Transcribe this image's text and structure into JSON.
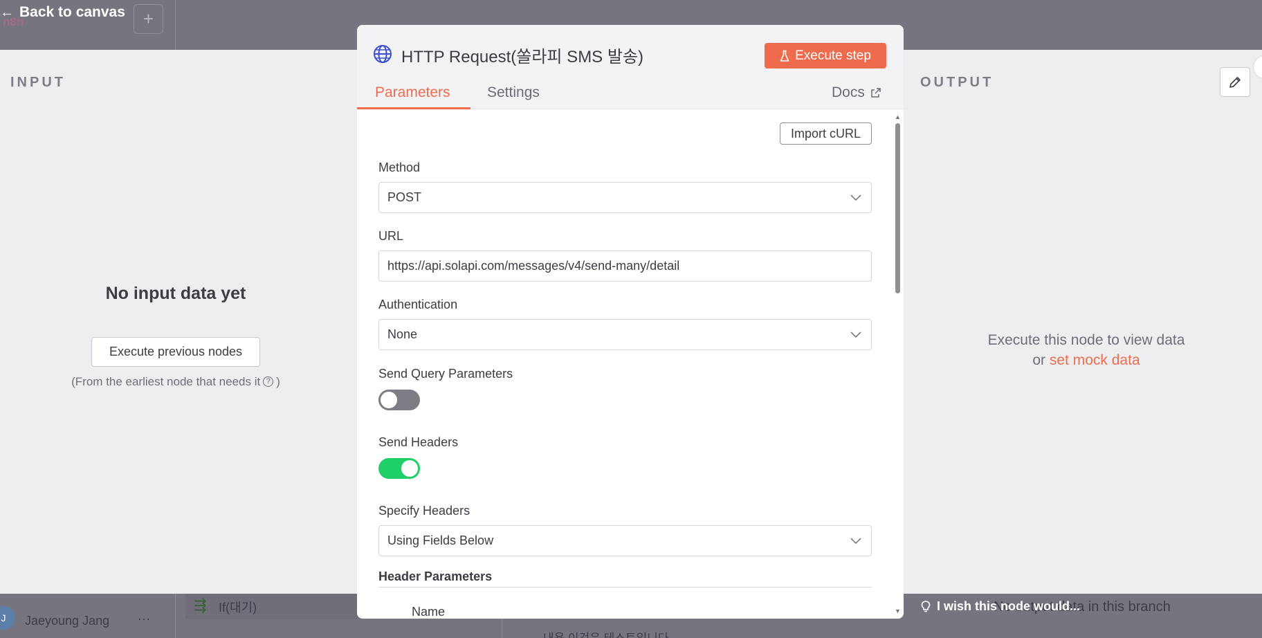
{
  "topbar": {
    "back_label": "Back to canvas",
    "back_arrow": "←",
    "logo_ghost": "n8n",
    "plus_label": "+"
  },
  "input_panel": {
    "title": "INPUT",
    "empty_title": "No input data yet",
    "execute_prev_label": "Execute previous nodes",
    "hint_prefix": "(From the earliest node that needs it",
    "hint_suffix": ")",
    "help_glyph": "?"
  },
  "output_panel": {
    "title": "OUTPUT",
    "execute_line": "Execute this node to view data",
    "or_text": "or",
    "mock_link": "set mock data"
  },
  "modal": {
    "title": "HTTP Request(쏠라피 SMS 발송)",
    "execute_step_label": "Execute step",
    "tabs": [
      {
        "label": "Parameters",
        "active": true
      },
      {
        "label": "Settings",
        "active": false
      }
    ],
    "docs_label": "Docs",
    "import_curl_label": "Import cURL",
    "method": {
      "label": "Method",
      "value": "POST"
    },
    "url": {
      "label": "URL",
      "value": "https://api.solapi.com/messages/v4/send-many/detail"
    },
    "authentication": {
      "label": "Authentication",
      "value": "None"
    },
    "send_query": {
      "label": "Send Query Parameters",
      "enabled": false
    },
    "send_headers": {
      "label": "Send Headers",
      "enabled": true
    },
    "specify_headers": {
      "label": "Specify Headers",
      "value": "Using Fields Below"
    },
    "header_parameters_label": "Header Parameters",
    "name_label": "Name"
  },
  "bottom": {
    "avatar_initial": "J",
    "user_name": "Jaeyoung Jang",
    "more": "···",
    "node_if_label": "If(대기)",
    "ghost_row": "내용   이것은 테스트입니다",
    "tip": "I wish this node would...",
    "branch_ghost": "No output data in this branch"
  },
  "colors": {
    "accent": "#ee6c4d",
    "toggle_on": "#1fcf68",
    "toggle_off": "#7c7c84",
    "overlay": "#75747f"
  },
  "icons": {
    "globe": "globe-icon",
    "flask": "flask-icon",
    "external": "external-link-icon",
    "chevron": "chevron-down-icon",
    "pencil": "pencil-icon",
    "bulb": "lightbulb-icon"
  }
}
